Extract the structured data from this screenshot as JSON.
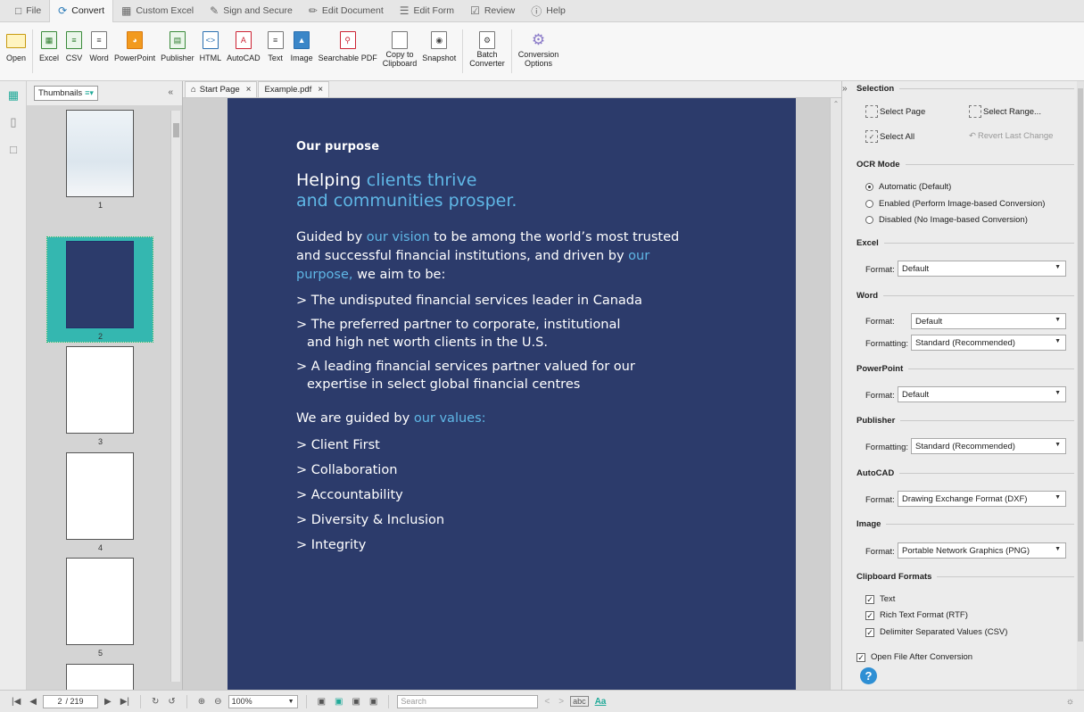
{
  "menubar": {
    "items": [
      {
        "label": "File",
        "icon": "file-icon"
      },
      {
        "label": "Convert",
        "icon": "convert-icon",
        "active": true
      },
      {
        "label": "Custom Excel",
        "icon": "grid-icon"
      },
      {
        "label": "Sign and Secure",
        "icon": "pen-icon"
      },
      {
        "label": "Edit Document",
        "icon": "edit-icon"
      },
      {
        "label": "Edit Form",
        "icon": "form-icon"
      },
      {
        "label": "Review",
        "icon": "review-icon"
      },
      {
        "label": "Help",
        "icon": "help-icon"
      }
    ]
  },
  "ribbon": {
    "open": "Open",
    "excel": "Excel",
    "csv": "CSV",
    "word": "Word",
    "powerpoint": "PowerPoint",
    "publisher": "Publisher",
    "html": "HTML",
    "autocad": "AutoCAD",
    "text": "Text",
    "image": "Image",
    "searchable_pdf": "Searchable PDF",
    "copy_to_clipboard_1": "Copy to",
    "copy_to_clipboard_2": "Clipboard",
    "snapshot": "Snapshot",
    "batch_converter_1": "Batch",
    "batch_converter_2": "Converter",
    "conversion_options_1": "Conversion",
    "conversion_options_2": "Options"
  },
  "thumbnails": {
    "selector_label": "Thumbnails",
    "pages": [
      "1",
      "2",
      "3",
      "4",
      "5"
    ]
  },
  "tabs": [
    {
      "label": "Start Page"
    },
    {
      "label": "Example.pdf"
    }
  ],
  "document": {
    "label": "Our purpose",
    "heading_a": "Helping ",
    "heading_b": "clients thrive",
    "heading_c": "and communities prosper.",
    "body_a": "Guided by ",
    "body_b": "our vision",
    "body_c": " to be among the world’s most trusted and successful financial institutions, and driven by ",
    "body_d": "our purpose,",
    "body_e": " we aim to be:",
    "items": [
      "> The undisputed financial services leader in Canada",
      "> The preferred partner to corporate, institutional and high net worth clients in the U.S.",
      "> A leading financial services partner valued for our expertise in select global financial centres"
    ],
    "values_a": "We are guided by ",
    "values_b": "our values:",
    "values": [
      "> Client First",
      "> Collaboration",
      "> Accountability",
      "> Diversity & Inclusion",
      "> Integrity"
    ]
  },
  "panel": {
    "selection": "Selection",
    "select_page": "Select Page",
    "select_range": "Select Range...",
    "select_all": "Select All",
    "revert": "Revert Last Change",
    "ocr_mode": "OCR Mode",
    "ocr_auto": "Automatic (Default)",
    "ocr_enabled": "Enabled (Perform Image-based Conversion)",
    "ocr_disabled": "Disabled (No Image-based Conversion)",
    "excel": "Excel",
    "format_label": "Format:",
    "formatting_label": "Formatting:",
    "excel_format": "Default",
    "word": "Word",
    "word_format": "Default",
    "word_formatting": "Standard (Recommended)",
    "powerpoint": "PowerPoint",
    "ppt_format": "Default",
    "publisher": "Publisher",
    "pub_formatting": "Standard (Recommended)",
    "autocad": "AutoCAD",
    "autocad_format": "Drawing Exchange Format (DXF)",
    "image": "Image",
    "image_format": "Portable Network Graphics (PNG)",
    "clipboard": "Clipboard Formats",
    "cb_text": "Text",
    "cb_rtf": "Rich Text Format (RTF)",
    "cb_csv": "Delimiter Separated Values (CSV)",
    "open_after": "Open File After Conversion"
  },
  "statusbar": {
    "page_current": "2",
    "page_total": "/ 219",
    "zoom": "100%",
    "search_placeholder": "Search"
  }
}
